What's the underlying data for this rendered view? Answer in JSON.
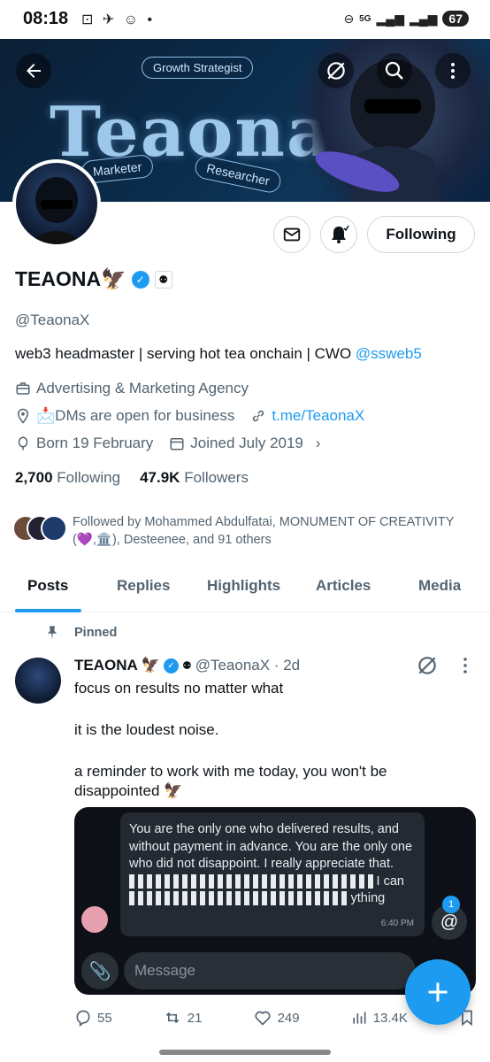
{
  "status_bar": {
    "time": "08:18",
    "left_icons": "⊡ ✈ ☺ •",
    "network": "5G",
    "battery": "67"
  },
  "banner": {
    "title": "Teaona",
    "pill_top": "Growth Strategist",
    "pill_left": "Marketer",
    "pill_right": "Researcher"
  },
  "profile": {
    "name": "TEAONA",
    "name_emoji": "🦅",
    "handle": "@TeaonaX",
    "bio_text": "web3 headmaster | serving hot tea onchain | CWO ",
    "bio_link": "@ssweb5",
    "category": "Advertising & Marketing Agency",
    "location": "📩DMs are open for business",
    "website": "t.me/TeaonaX",
    "birthday": "Born 19 February",
    "joined": "Joined July 2019",
    "following_count": "2,700",
    "following_label": "Following",
    "followers_count": "47.9K",
    "followers_label": "Followers",
    "followed_by_line1": "Followed by Mohammed Abdulfatai, MONUMENT OF CREATIVITY",
    "followed_by_line2": "(💜,🏛️), Desteenee, and 91 others"
  },
  "buttons": {
    "following": "Following"
  },
  "tabs": [
    "Posts",
    "Replies",
    "Highlights",
    "Articles",
    "Media"
  ],
  "post": {
    "pinned_label": "Pinned",
    "author": "TEAONA",
    "author_emoji": "🦅",
    "handle_time": "@TeaonaX · 2d",
    "line1": "focus on results no matter what",
    "line2": "it is the loudest noise.",
    "line3": "a reminder to work with me today, you won't be",
    "line4": "disappointed 🦅",
    "media": {
      "message_text": "You are the only one who delivered results, and without payment in advance. You are the only one who did not disappoint. I really appreciate that. ",
      "message_text_tail": "I can",
      "message_text_end": "ything",
      "message_time": "6:40 PM",
      "input_placeholder": "Message",
      "mention_badge": "1"
    },
    "replies": "55",
    "reposts": "21",
    "likes": "249",
    "views": "13.4K"
  },
  "colors": {
    "accent": "#1d9bf0",
    "banner_bg": "#0c1f36"
  },
  "icons": [
    "back-arrow-icon",
    "grok-icon",
    "search-icon",
    "more-vert-icon",
    "mail-icon",
    "bell-icon",
    "briefcase-icon",
    "location-icon",
    "link-icon",
    "balloon-icon",
    "calendar-icon",
    "pin-icon",
    "reply-icon",
    "repost-icon",
    "like-icon",
    "views-icon",
    "bookmark-icon",
    "plus-icon"
  ]
}
